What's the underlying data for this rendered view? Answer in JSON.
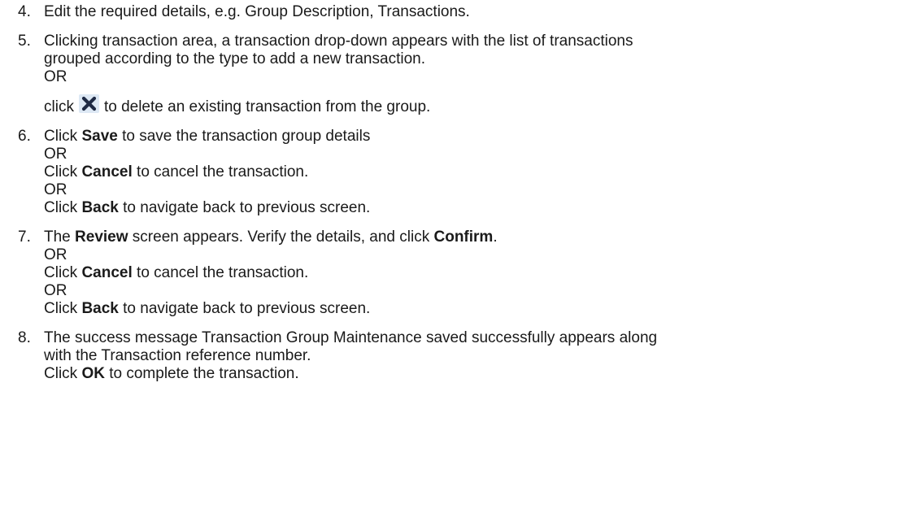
{
  "steps": [
    {
      "num": "4.",
      "text": "Edit the required details, e.g. Group Description, Transactions."
    },
    {
      "num": "5.",
      "line1": "Clicking transaction area, a transaction drop-down appears with the list of transactions",
      "line2": "grouped according to the type to add a new transaction.",
      "or": "OR",
      "click_pre": "click",
      "click_post": "to delete an existing transaction from the group.",
      "icon": "delete-x-icon"
    },
    {
      "num": "6.",
      "a_pre": "Click ",
      "a_bold": "Save",
      "a_post": " to save the transaction group details",
      "or1": "OR",
      "b_pre": "Click ",
      "b_bold": "Cancel",
      "b_post": " to cancel the transaction.",
      "or2": "OR",
      "c_pre": "Click ",
      "c_bold": "Back",
      "c_post": " to navigate back to previous screen."
    },
    {
      "num": "7.",
      "a_pre": "The ",
      "a_bold1": "Review",
      "a_mid": " screen appears. Verify the details, and click ",
      "a_bold2": "Confirm",
      "a_end": ".",
      "or1": "OR",
      "b_pre": "Click ",
      "b_bold": "Cancel",
      "b_post": " to cancel the transaction.",
      "or2": "OR",
      "c_pre": "Click ",
      "c_bold": "Back",
      "c_post": " to navigate back to previous screen."
    },
    {
      "num": "8.",
      "line1": "The success message Transaction Group Maintenance saved successfully appears along",
      "line2": "with the Transaction reference number.",
      "c_pre": "Click ",
      "c_bold": "OK",
      "c_post": " to complete the transaction."
    }
  ],
  "colors": {
    "text": "#1a1a1a",
    "icon_bg": "#dde8f4",
    "icon_x": "#1f2a44"
  }
}
